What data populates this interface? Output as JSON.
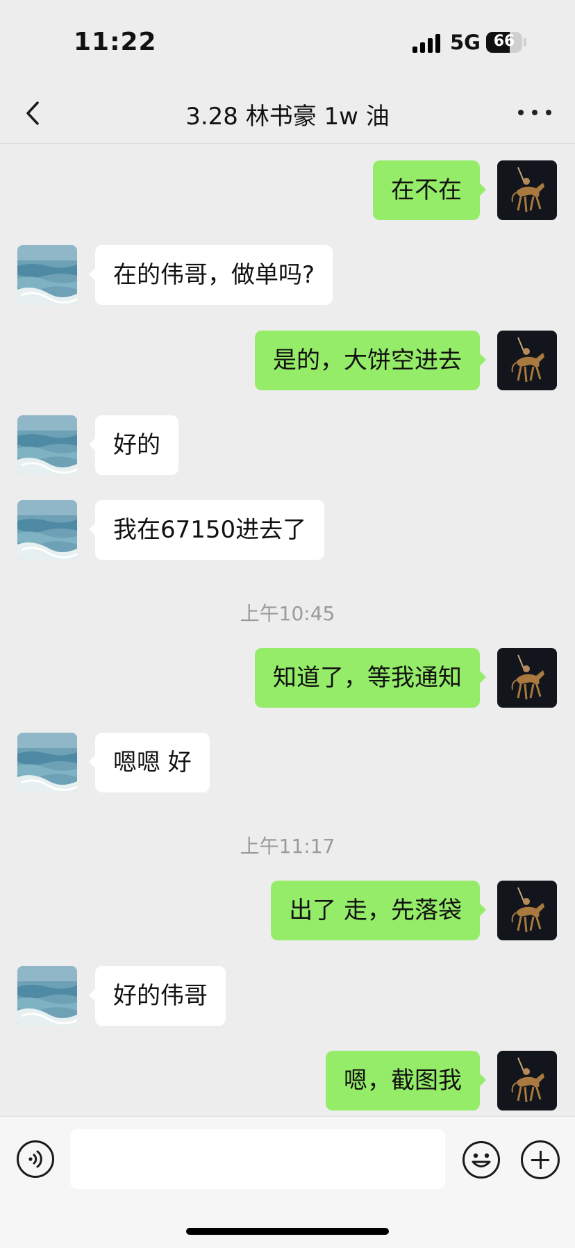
{
  "status_bar": {
    "time": "11:22",
    "network": "5G",
    "battery": "66",
    "battery_level": 0.66,
    "signal_bars": 4
  },
  "header": {
    "title": "3.28 林书豪 1w 油",
    "back_icon": "chevron-left-icon",
    "more_icon": "ellipsis-icon"
  },
  "messages": [
    {
      "sender": "me",
      "text": "在不在"
    },
    {
      "sender": "other",
      "text": "在的伟哥，做单吗?"
    },
    {
      "sender": "me",
      "text": "是的，大饼空进去"
    },
    {
      "sender": "other",
      "text": "好的"
    },
    {
      "sender": "other",
      "text": "我在67150进去了"
    },
    {
      "type": "timestamp",
      "text": "上午10:45"
    },
    {
      "sender": "me",
      "text": "知道了，等我通知"
    },
    {
      "sender": "other",
      "text": "嗯嗯 好"
    },
    {
      "type": "timestamp",
      "text": "上午11:17"
    },
    {
      "sender": "me",
      "text": "出了 走，先落袋"
    },
    {
      "sender": "other",
      "text": "好的伟哥"
    },
    {
      "sender": "me",
      "text": "嗯，截图我"
    }
  ],
  "input_bar": {
    "value": "",
    "voice_icon": "voice-icon",
    "emoji_icon": "emoji-icon",
    "plus_icon": "plus-icon"
  },
  "colors": {
    "background": "#ededed",
    "my_bubble": "#95ec69",
    "their_bubble": "#ffffff",
    "timestamp": "#9a9a9a"
  }
}
